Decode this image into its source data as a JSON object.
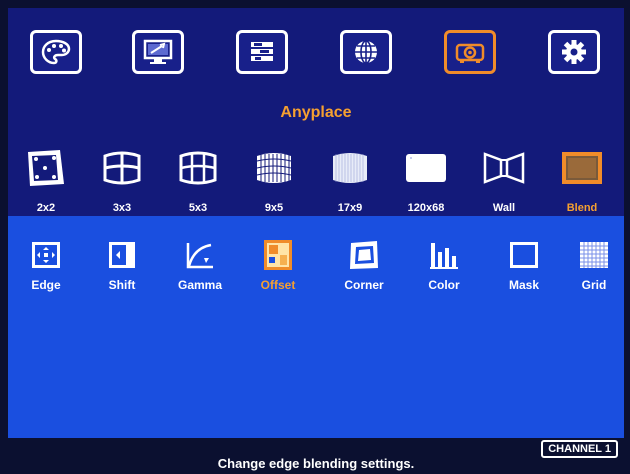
{
  "top_tabs": [
    {
      "icon": "palette-icon",
      "active": false
    },
    {
      "icon": "monitor-tools-icon",
      "active": false
    },
    {
      "icon": "input-source-icon",
      "active": false
    },
    {
      "icon": "globe-icon",
      "active": false
    },
    {
      "icon": "projector-icon",
      "active": true
    },
    {
      "icon": "gear-icon",
      "active": false
    }
  ],
  "section_title": "Anyplace",
  "layouts": [
    {
      "label": "2x2",
      "icon": "warp-2x2-icon",
      "active": false
    },
    {
      "label": "3x3",
      "icon": "grid-3x3-icon",
      "active": false
    },
    {
      "label": "5x3",
      "icon": "grid-5x3-icon",
      "active": false
    },
    {
      "label": "9x5",
      "icon": "grid-9x5-icon",
      "active": false
    },
    {
      "label": "17x9",
      "icon": "grid-17x9-icon",
      "active": false
    },
    {
      "label": "120x68",
      "icon": "grid-120x68-icon",
      "active": false
    },
    {
      "label": "Wall",
      "icon": "wall-icon",
      "active": false
    },
    {
      "label": "Blend",
      "icon": "blend-icon",
      "active": true
    }
  ],
  "sub_options": [
    {
      "label": "Edge",
      "icon": "edge-icon",
      "active": false
    },
    {
      "label": "Shift",
      "icon": "shift-icon",
      "active": false
    },
    {
      "label": "Gamma",
      "icon": "gamma-icon",
      "active": false
    },
    {
      "label": "Offset",
      "icon": "offset-icon",
      "active": true
    },
    {
      "label": "Corner",
      "icon": "corner-icon",
      "active": false
    },
    {
      "label": "Color",
      "icon": "color-bars-icon",
      "active": false
    },
    {
      "label": "Mask",
      "icon": "mask-icon",
      "active": false
    },
    {
      "label": "Grid",
      "icon": "grid-icon",
      "active": false
    }
  ],
  "status": {
    "channel": "CHANNEL 1",
    "message": "Change edge blending settings."
  },
  "colors": {
    "top_panel": "#131a7a",
    "sub_panel": "#1a4fe0",
    "accent": "#f5a030"
  }
}
